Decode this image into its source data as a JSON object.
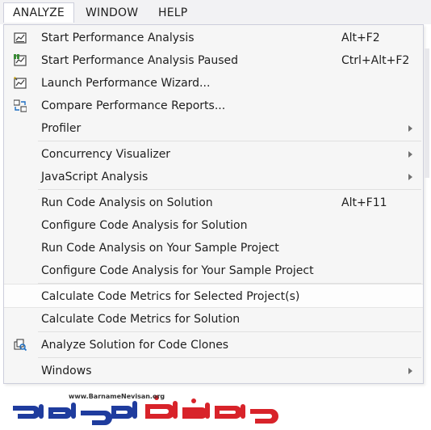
{
  "menubar": {
    "items": [
      {
        "label": "ANALYZE"
      },
      {
        "label": "WINDOW"
      },
      {
        "label": "HELP"
      }
    ]
  },
  "menu": {
    "items": [
      {
        "label": "Start Performance Analysis",
        "shortcut": "Alt+F2",
        "icon": "performance-analysis-icon"
      },
      {
        "label": "Start Performance Analysis Paused",
        "shortcut": "Ctrl+Alt+F2",
        "icon": "performance-analysis-paused-icon"
      },
      {
        "label": "Launch Performance Wizard...",
        "icon": "performance-wizard-icon"
      },
      {
        "label": "Compare Performance Reports...",
        "icon": "compare-reports-icon"
      },
      {
        "label": "Profiler",
        "submenu": true
      },
      {
        "label": "Concurrency Visualizer",
        "submenu": true
      },
      {
        "label": "JavaScript Analysis",
        "submenu": true
      },
      {
        "label": "Run Code Analysis on Solution",
        "shortcut": "Alt+F11"
      },
      {
        "label": "Configure Code Analysis for Solution"
      },
      {
        "label": "Run Code Analysis on Your Sample Project"
      },
      {
        "label": "Configure Code Analysis for Your Sample Project"
      },
      {
        "label": "Calculate Code Metrics for Selected Project(s)",
        "highlighted": true
      },
      {
        "label": "Calculate Code Metrics for Solution"
      },
      {
        "label": "Analyze Solution for Code Clones",
        "icon": "code-clones-icon"
      },
      {
        "label": "Windows",
        "submenu": true
      }
    ]
  },
  "watermark": {
    "url": "www.BarnameNevisan.org",
    "logo_text": "برنامه نویسان"
  },
  "colors": {
    "menu_bg": "#f6f6f6",
    "menubar_bg": "#f2f2f4",
    "logo_blue": "#1f3c9e",
    "logo_red": "#d8232a"
  }
}
